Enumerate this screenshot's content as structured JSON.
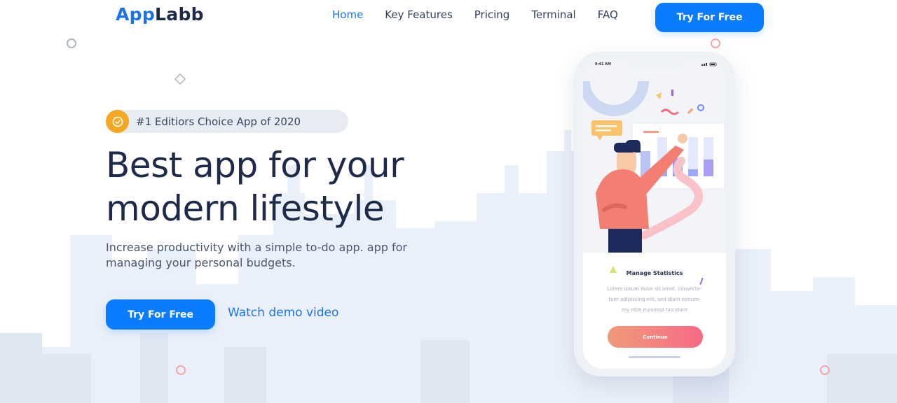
{
  "brand": {
    "part1": "App",
    "part2": "Labb"
  },
  "nav": {
    "items": [
      {
        "label": "Home",
        "active": true
      },
      {
        "label": "Key Features"
      },
      {
        "label": "Pricing"
      },
      {
        "label": "Terminal"
      },
      {
        "label": "FAQ"
      }
    ],
    "cta_label": "Try For Free"
  },
  "hero": {
    "badge": {
      "icon": "check-circle-icon",
      "text": "#1 Editiors Choice App of 2020"
    },
    "headline_line1": "Best app for your",
    "headline_line2": "modern lifestyle",
    "subtext_line1": "Increase productivity with a simple to-do app. app for",
    "subtext_line2": "managing your personal budgets.",
    "cta_label": "Try For Free",
    "link_label": "Watch demo video"
  },
  "phone": {
    "status_time": "9:41 AM",
    "status_icons": "wifi-icon battery-icon",
    "card_title": "Manage Statistics",
    "card_text_line1": "Lorem ipsum dolor sit amet, consecte-",
    "card_text_line2": "tuer adipiscing elit, sed diam nonum-",
    "card_text_line3": "my nibh euismod tincidunt",
    "button_label": "Continue"
  },
  "colors": {
    "primary": "#0a7cff",
    "brand_blue": "#1a73e8",
    "headline": "#1e2a4a",
    "badge_icon": "#f5a623",
    "skyline": "#e8eff8",
    "deco_ring": "#f2a8a8"
  }
}
